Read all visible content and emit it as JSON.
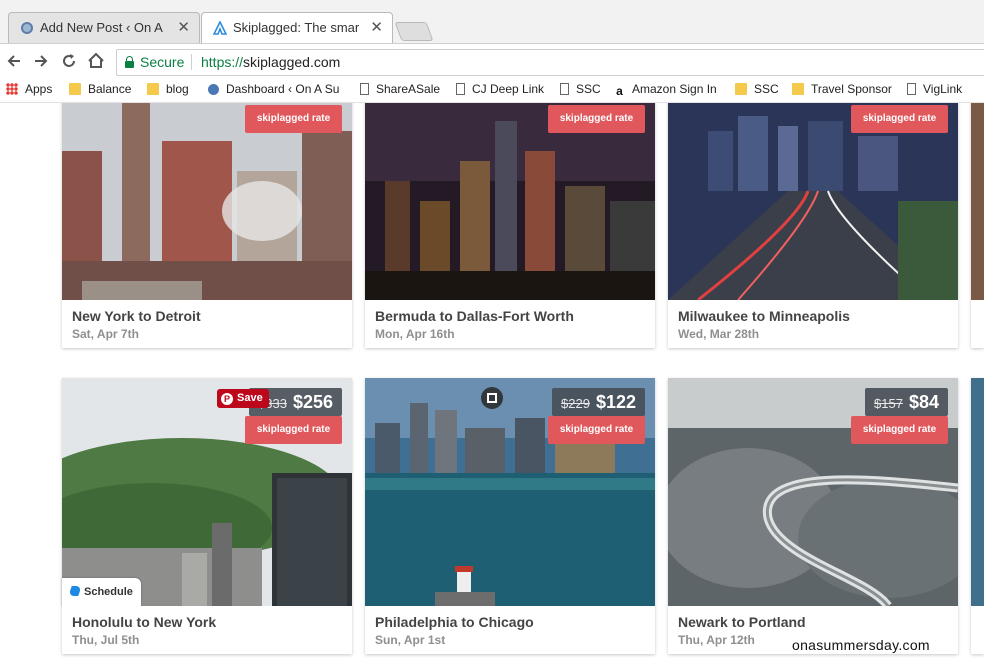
{
  "browser": {
    "tabs": [
      {
        "title": "Add New Post ‹ On A Summer's Day",
        "active": false
      },
      {
        "title": "Skiplagged: The smart way to find cheap flights",
        "active": true
      }
    ],
    "close_glyph": "✕",
    "omnibox": {
      "security_label": "Secure",
      "url_scheme": "https://",
      "url_host": "skiplagged.com"
    },
    "bookmarks": [
      {
        "label": "Apps",
        "icon": "apps-grid-icon"
      },
      {
        "label": "Balance",
        "icon": "folder-icon"
      },
      {
        "label": "blog",
        "icon": "folder-icon"
      },
      {
        "label": "Dashboard ‹ On A Su",
        "icon": "wordpress-icon"
      },
      {
        "label": "ShareASale",
        "icon": "page-icon"
      },
      {
        "label": "CJ Deep Link",
        "icon": "page-icon"
      },
      {
        "label": "SSC",
        "icon": "page-icon"
      },
      {
        "label": "Amazon Sign In",
        "icon": "amazon-icon"
      },
      {
        "label": "SSC",
        "icon": "folder-icon"
      },
      {
        "label": "Travel Sponsor",
        "icon": "folder-icon"
      },
      {
        "label": "VigLink",
        "icon": "page-icon"
      }
    ]
  },
  "deals": {
    "rate_label": "skiplagged rate",
    "cards": [
      {
        "route": "New York to Detroit",
        "date": "Sat, Apr 7th"
      },
      {
        "route": "Bermuda to Dallas-Fort Worth",
        "date": "Mon, Apr 16th"
      },
      {
        "route": "Milwaukee to Minneapolis",
        "date": "Wed, Mar 28th"
      },
      {
        "route": "Honolulu to New York",
        "date": "Thu, Jul 5th",
        "old_price": "$333",
        "new_price": "$256"
      },
      {
        "route": "Philadelphia to Chicago",
        "date": "Sun, Apr 1st",
        "old_price": "$229",
        "new_price": "$122"
      },
      {
        "route": "Newark to Portland",
        "date": "Thu, Apr 12th",
        "old_price": "$157",
        "new_price": "$84"
      }
    ]
  },
  "overlays": {
    "pinterest_label": "Save",
    "pinterest_glyph": "P",
    "schedule_label": "Schedule",
    "watermark": "onasummersday.com"
  },
  "colors": {
    "rate_badge": "#e1585c",
    "price_box": "#464e56",
    "secure_green": "#0b8043",
    "pinterest_red": "#bd081c"
  }
}
